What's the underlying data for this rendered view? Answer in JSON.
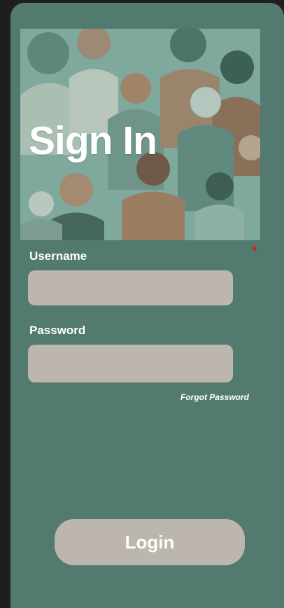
{
  "header": {
    "title": "Sign In"
  },
  "form": {
    "username_label": "Username",
    "username_value": "",
    "password_label": "Password",
    "password_value": "",
    "forgot_label": "Forgot Password",
    "login_label": "Login"
  },
  "colors": {
    "background": "#527a6e",
    "field": "#bdb6ae",
    "text": "#ffffff",
    "dot": "#e01f1f"
  }
}
